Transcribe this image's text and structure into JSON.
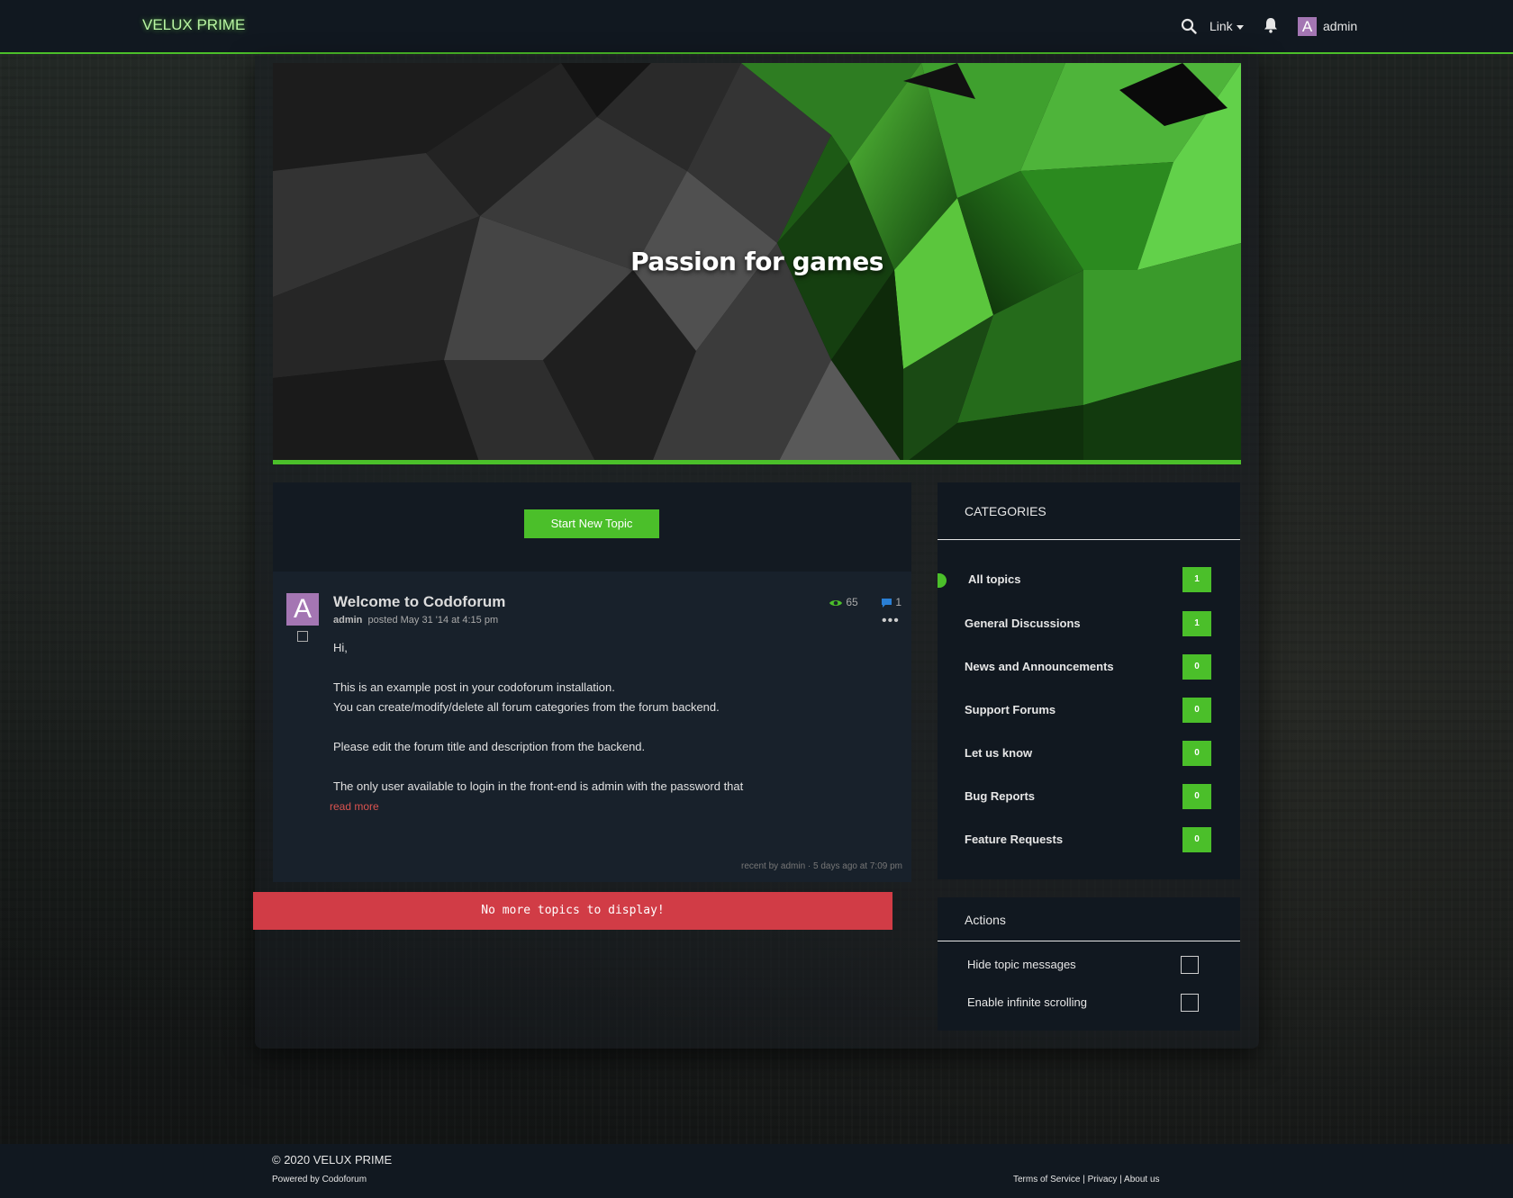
{
  "navbar": {
    "brand": "VELUX PRIME",
    "link_label": "Link",
    "avatar_letter": "A",
    "username": "admin"
  },
  "hero": {
    "title": "Passion for games"
  },
  "topics": {
    "start_button": "Start New Topic",
    "post": {
      "avatar_letter": "A",
      "title": "Welcome to Codoforum",
      "author": "admin",
      "posted": "posted May 31 '14 at 4:15 pm",
      "views": "65",
      "replies": "1",
      "body": [
        "Hi,",
        "",
        "This is an example post in your codoforum installation.",
        "You can create/modify/delete all forum categories from the forum backend.",
        "",
        "Please edit the forum title and description from the backend.",
        "",
        "The only user available to login in the front-end is admin with the password that"
      ],
      "read_more": "read more",
      "recent": "recent by admin · 5 days ago at 7:09 pm"
    },
    "no_more": "No more topics to display!"
  },
  "categories": {
    "title": "CATEGORIES",
    "items": [
      {
        "label": "All topics",
        "count": "1",
        "active": true
      },
      {
        "label": "General Discussions",
        "count": "1"
      },
      {
        "label": "News and Announcements",
        "count": "0"
      },
      {
        "label": "Support Forums",
        "count": "0"
      },
      {
        "label": "Let us know",
        "count": "0"
      },
      {
        "label": "Bug Reports",
        "count": "0"
      },
      {
        "label": "Feature Requests",
        "count": "0"
      }
    ]
  },
  "actions": {
    "title": "Actions",
    "items": [
      {
        "label": "Hide topic messages",
        "checked": false
      },
      {
        "label": "Enable infinite scrolling",
        "checked": false
      }
    ]
  },
  "footer": {
    "copyright": "© 2020 VELUX PRIME",
    "powered": "Powered by Codoforum",
    "links": [
      "Terms of Service",
      "Privacy",
      "About us"
    ]
  },
  "colors": {
    "accent": "#4bbf2a",
    "danger": "#d13c46",
    "avatar": "#a476b3",
    "panel": "#111820"
  },
  "icons": [
    "search-icon",
    "bell-icon",
    "eye-icon",
    "comment-icon",
    "more-icon"
  ]
}
